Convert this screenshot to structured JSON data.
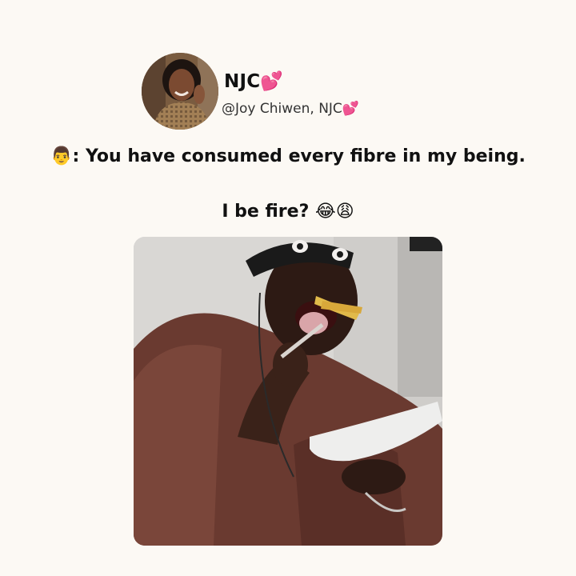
{
  "post": {
    "author": {
      "display_name": "NJC",
      "display_name_emoji": "💕",
      "handle": "@Joy Chiwen, NJC",
      "handle_emoji": "💕",
      "avatar_icon": "profile-photo-woman-smiling"
    },
    "text": {
      "speaker_emoji": "👨",
      "line1": ": You have consumed every fibre in my being.",
      "line2": "I be fire?",
      "line2_emojis": "😂😩"
    },
    "media": {
      "type": "photo",
      "description_icon": "man-eating-fries-photo"
    },
    "colors": {
      "background": "#fcf9f4",
      "text": "#111111",
      "heart": "#ee4f8e"
    }
  }
}
